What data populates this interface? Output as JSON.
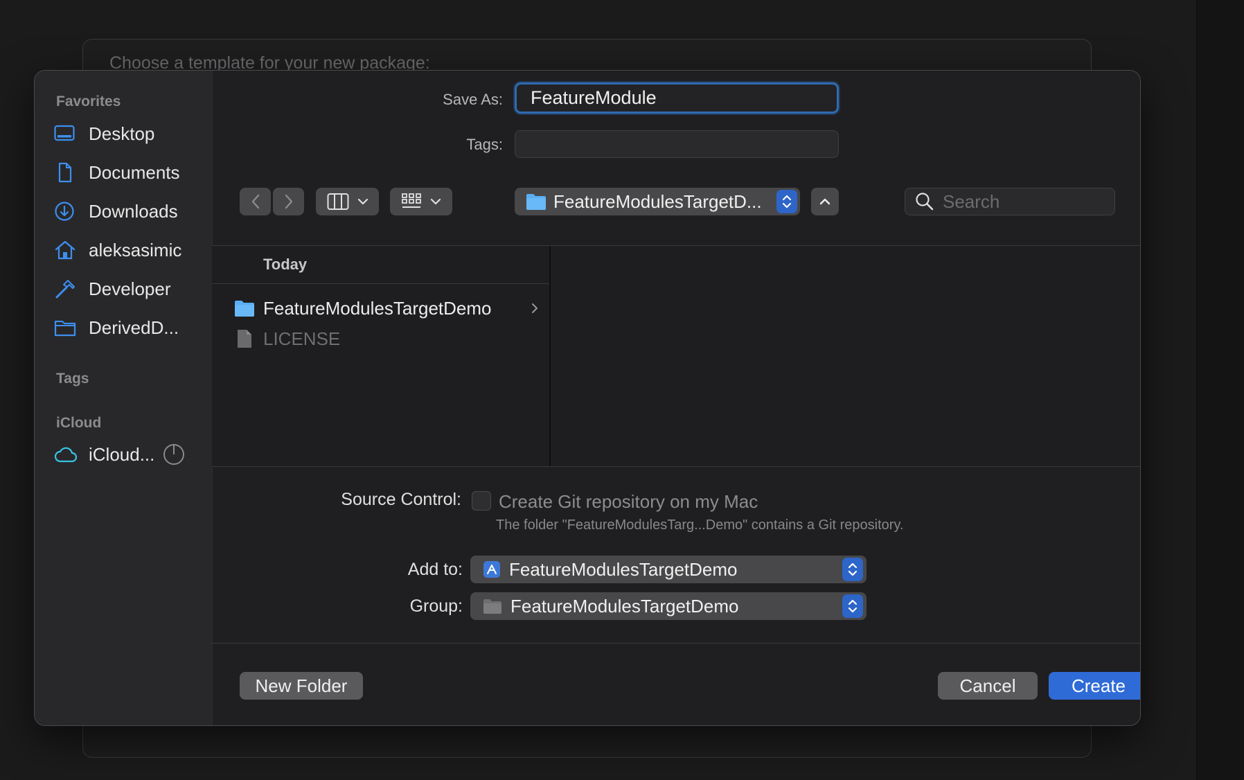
{
  "background_sheet": {
    "title": "Choose a template for your new package:"
  },
  "sidebar": {
    "favorites_heading": "Favorites",
    "favorites": [
      {
        "label": "Desktop",
        "icon": "desktop-icon"
      },
      {
        "label": "Documents",
        "icon": "document-icon"
      },
      {
        "label": "Downloads",
        "icon": "downloads-icon"
      },
      {
        "label": "aleksasimic",
        "icon": "home-icon"
      },
      {
        "label": "Developer",
        "icon": "hammer-icon"
      },
      {
        "label": "DerivedD...",
        "icon": "folder-icon"
      }
    ],
    "tags_heading": "Tags",
    "icloud_heading": "iCloud",
    "icloud": [
      {
        "label": "iCloud...",
        "icon": "cloud-icon"
      }
    ]
  },
  "form": {
    "save_as_label": "Save As:",
    "save_as_value": "FeatureModule",
    "tags_label": "Tags:",
    "tags_value": ""
  },
  "toolbar": {
    "location": "FeatureModulesTargetD...",
    "search_placeholder": "Search"
  },
  "browser": {
    "column_header": "Today",
    "items": [
      {
        "name": "FeatureModulesTargetDemo",
        "kind": "folder",
        "enabled": true
      },
      {
        "name": "LICENSE",
        "kind": "file",
        "enabled": false
      }
    ]
  },
  "options": {
    "source_control_label": "Source Control:",
    "git_checkbox_label": "Create Git repository on my Mac",
    "git_checked": false,
    "git_note": "The folder \"FeatureModulesTarg...Demo\" contains a Git repository.",
    "add_to_label": "Add to:",
    "add_to_value": "FeatureModulesTargetDemo",
    "group_label": "Group:",
    "group_value": "FeatureModulesTargetDemo"
  },
  "buttons": {
    "new_folder": "New Folder",
    "cancel": "Cancel",
    "create": "Create"
  },
  "colors": {
    "accent": "#2f6bd6",
    "folder_blue": "#5aaef5",
    "sidebar_icon": "#3d8ff0"
  }
}
